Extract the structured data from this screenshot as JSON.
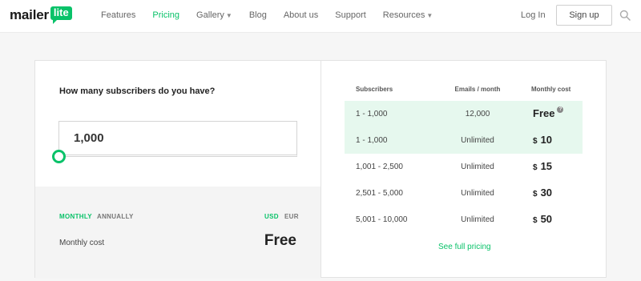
{
  "brand": {
    "word": "mailer",
    "badge": "lite",
    "accent": "#09c269"
  },
  "nav": {
    "items": [
      {
        "label": "Features"
      },
      {
        "label": "Pricing",
        "active": true
      },
      {
        "label": "Gallery",
        "has_dropdown": true
      },
      {
        "label": "Blog"
      },
      {
        "label": "About us"
      },
      {
        "label": "Support"
      },
      {
        "label": "Resources",
        "has_dropdown": true
      }
    ],
    "login": "Log In",
    "signup": "Sign up"
  },
  "calculator": {
    "question": "How many subscribers do you have?",
    "subscribers_value": "1,000",
    "billing": {
      "monthly": "MONTHLY",
      "annually": "ANNUALLY",
      "selected": "monthly"
    },
    "currency": {
      "usd": "USD",
      "eur": "EUR",
      "selected": "usd"
    },
    "cost_label": "Monthly cost",
    "cost_value": "Free"
  },
  "pricing_table": {
    "headers": {
      "subscribers": "Subscribers",
      "emails": "Emails / month",
      "cost": "Monthly cost"
    },
    "rows": [
      {
        "subscribers": "1 - 1,000",
        "emails": "12,000",
        "currency": "",
        "cost": "Free",
        "info": "?",
        "highlight": true
      },
      {
        "subscribers": "1 - 1,000",
        "emails": "Unlimited",
        "currency": "$",
        "cost": "10",
        "highlight": true
      },
      {
        "subscribers": "1,001 - 2,500",
        "emails": "Unlimited",
        "currency": "$",
        "cost": "15"
      },
      {
        "subscribers": "2,501 - 5,000",
        "emails": "Unlimited",
        "currency": "$",
        "cost": "30"
      },
      {
        "subscribers": "5,001 - 10,000",
        "emails": "Unlimited",
        "currency": "$",
        "cost": "50"
      }
    ],
    "see_full": "See full pricing"
  }
}
